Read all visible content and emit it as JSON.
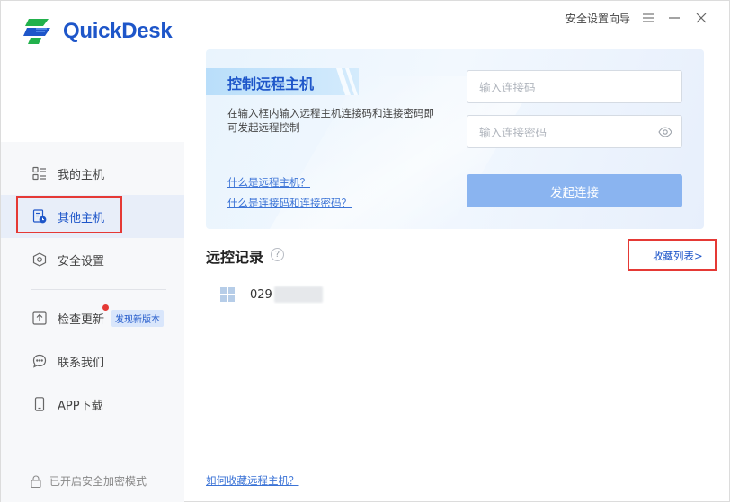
{
  "app": {
    "name": "QuickDesk",
    "brand_color": "#1e56c9",
    "accent_light": "#8ab4f0",
    "highlight_color": "#e53935"
  },
  "titlebar": {
    "guide": "安全设置向导",
    "menu_icon": "menu-icon",
    "minimize_icon": "minimize-icon",
    "close_icon": "close-icon"
  },
  "sidebar": {
    "items": [
      {
        "label": "我的主机",
        "icon": "host-list-icon"
      },
      {
        "label": "其他主机",
        "icon": "remote-host-icon",
        "active": true
      },
      {
        "label": "安全设置",
        "icon": "shield-icon"
      },
      {
        "label": "检查更新",
        "icon": "update-icon",
        "badge": "发现新版本"
      },
      {
        "label": "联系我们",
        "icon": "chat-icon"
      },
      {
        "label": "APP下载",
        "icon": "phone-icon"
      }
    ],
    "secure_mode": "已开启安全加密模式"
  },
  "connect": {
    "title": "控制远程主机",
    "description": "在输入框内输入远程主机连接码和连接密码即可发起远程控制",
    "link_what_is": "什么是远程主机？",
    "link_what_code": "什么是连接码和连接密码？",
    "code_placeholder": "输入连接码",
    "password_placeholder": "输入连接密码",
    "connect_button": "发起连接"
  },
  "records": {
    "title": "远控记录",
    "favorites_link": "收藏列表>",
    "items": [
      {
        "label": "029"
      }
    ],
    "bottom_link": "如何收藏远程主机？"
  }
}
